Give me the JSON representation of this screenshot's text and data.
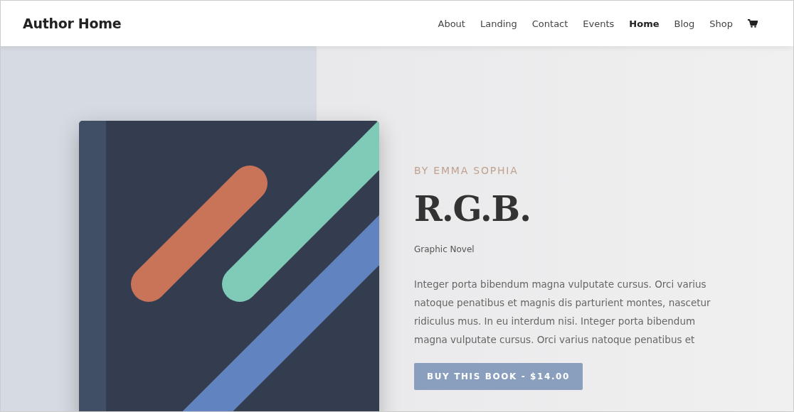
{
  "header": {
    "site_title": "Author Home",
    "nav": [
      {
        "label": "About",
        "selected": false
      },
      {
        "label": "Landing",
        "selected": false
      },
      {
        "label": "Contact",
        "selected": false
      },
      {
        "label": "Events",
        "selected": false
      },
      {
        "label": "Home",
        "selected": true
      },
      {
        "label": "Blog",
        "selected": false
      },
      {
        "label": "Shop",
        "selected": false
      }
    ]
  },
  "book": {
    "byline": "BY EMMA SOPHIA",
    "title": "R.G.B.",
    "genre": "Graphic Novel",
    "description": "Integer porta bibendum magna vulputate cursus. Orci varius natoque penatibus et magnis dis parturient montes, nascetur ridiculus mus. In eu interdum nisi. Integer porta bibendum magna vulputate cursus. Orci varius natoque penatibus et",
    "buy_button": "BUY THIS BOOK - $14.00"
  }
}
